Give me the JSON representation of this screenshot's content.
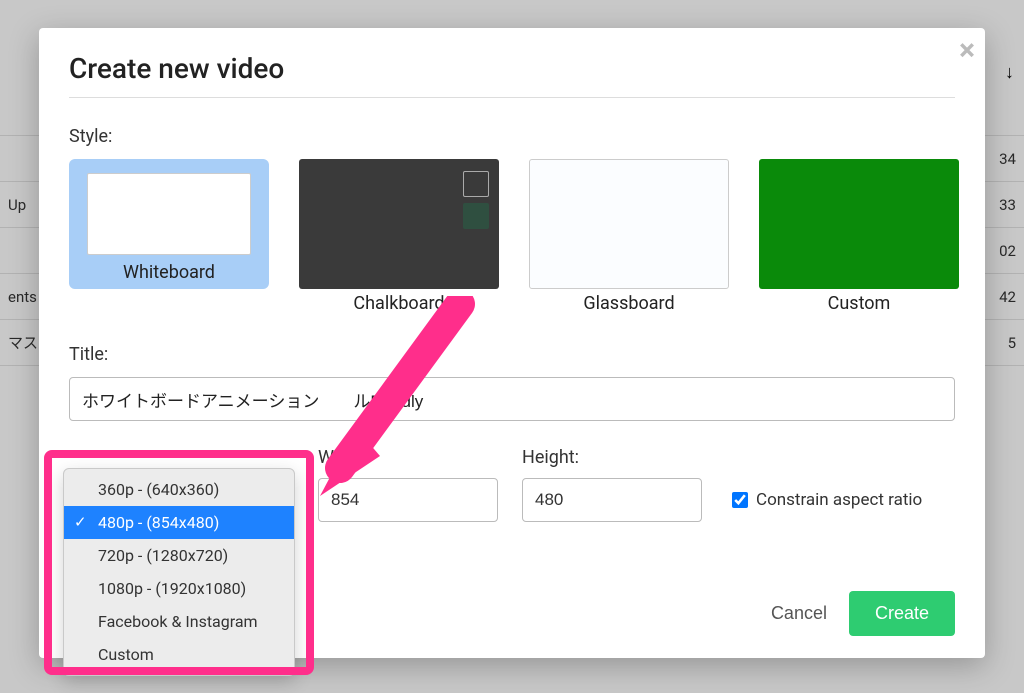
{
  "background": {
    "left_labels": [
      "Up",
      "ents",
      "マス"
    ],
    "right_numbers": [
      "34",
      "33",
      "02",
      "42",
      "5"
    ]
  },
  "modal": {
    "title": "Create new video",
    "close_label": "×",
    "style_label": "Style:",
    "styles": {
      "whiteboard": "Whiteboard",
      "chalkboard": "Chalkboard",
      "glassboard": "Glassboard",
      "custom": "Custom"
    },
    "title_field": {
      "label": "Title:",
      "value": "ホワイトボードアニメーション　　ルDoodly"
    },
    "dims": {
      "width_label": "Width:",
      "height_label": "Height:",
      "width_value": "854",
      "height_value": "480",
      "constrain_label": "Constrain aspect ratio",
      "constrain_checked": true
    },
    "footer": {
      "cancel": "Cancel",
      "create": "Create"
    }
  },
  "size_dropdown": {
    "items": [
      "360p  -  (640x360)",
      "480p  -  (854x480)",
      "720p  -  (1280x720)",
      "1080p  -  (1920x1080)",
      "Facebook & Instagram",
      "Custom"
    ],
    "selected_index": 1
  }
}
